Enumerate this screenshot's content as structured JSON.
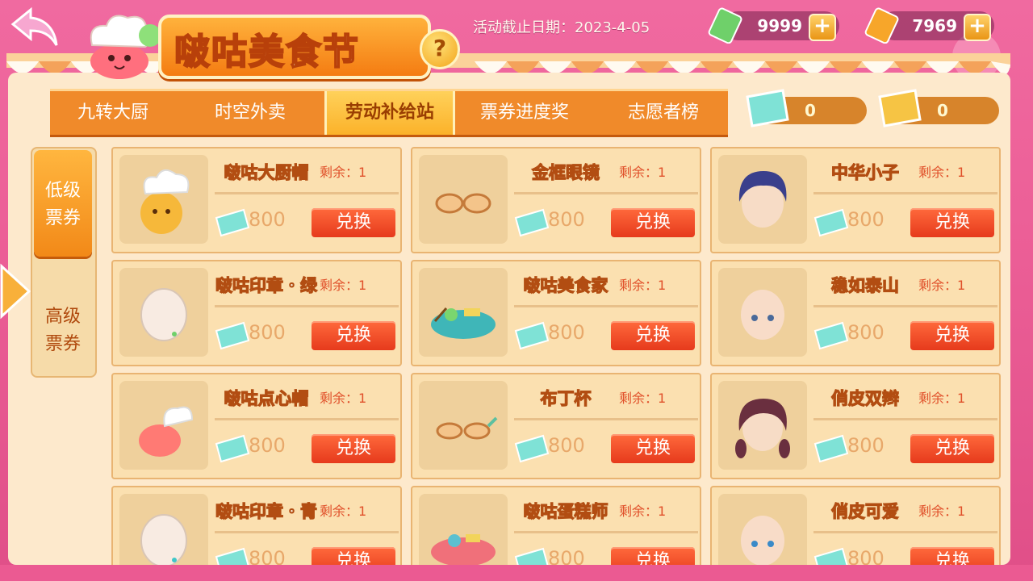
{
  "header": {
    "title": "啵咕美食节",
    "help_label": "?",
    "deadline": "活动截止日期：2023-4-05",
    "currency_green": {
      "amount": "9999",
      "icon": "green-ticket-icon"
    },
    "currency_gold": {
      "amount": "7969",
      "icon": "gold-ticket-icon"
    },
    "plus_label": "+"
  },
  "tabs": [
    {
      "label": "九转大厨",
      "active": false
    },
    {
      "label": "时空外卖",
      "active": false
    },
    {
      "label": "劳动补给站",
      "active": true
    },
    {
      "label": "票券进度奖",
      "active": false
    },
    {
      "label": "志愿者榜",
      "active": false
    }
  ],
  "tickets": {
    "low": {
      "count": "0",
      "icon": "cyan-ticket-icon"
    },
    "high": {
      "count": "0",
      "icon": "gold-ticket-icon"
    }
  },
  "side_tabs": [
    {
      "line1": "低级",
      "line2": "票券",
      "active": true
    },
    {
      "line1": "高级",
      "line2": "票券",
      "active": false
    }
  ],
  "items": [
    {
      "name": "啵咕大厨帽",
      "remain": "剩余：1",
      "price": "800",
      "button": "兑换",
      "icon": "chef-hat-icon"
    },
    {
      "name": "金框眼镜",
      "remain": "剩余：1",
      "price": "800",
      "button": "兑换",
      "icon": "glasses-icon"
    },
    {
      "name": "中华小子",
      "remain": "剩余：1",
      "price": "800",
      "button": "兑换",
      "icon": "blue-hair-head-icon"
    },
    {
      "name": "啵咕印章・绿",
      "remain": "剩余：1",
      "price": "800",
      "button": "兑换",
      "icon": "green-stamp-head-icon"
    },
    {
      "name": "啵咕美食家",
      "remain": "剩余：1",
      "price": "800",
      "button": "兑换",
      "icon": "food-mount-icon"
    },
    {
      "name": "稳如泰山",
      "remain": "剩余：1",
      "price": "800",
      "button": "兑换",
      "icon": "bald-head-icon"
    },
    {
      "name": "啵咕点心帽",
      "remain": "剩余：1",
      "price": "800",
      "button": "兑换",
      "icon": "dessert-hat-icon"
    },
    {
      "name": "布丁杯",
      "remain": "剩余：1",
      "price": "800",
      "button": "兑换",
      "icon": "pudding-glasses-icon"
    },
    {
      "name": "俏皮双辫",
      "remain": "剩余：1",
      "price": "800",
      "button": "兑换",
      "icon": "braids-head-icon"
    },
    {
      "name": "啵咕印章・青",
      "remain": "剩余：1",
      "price": "800",
      "button": "兑换",
      "icon": "cyan-stamp-head-icon"
    },
    {
      "name": "啵咕蛋糕师",
      "remain": "剩余：1",
      "price": "800",
      "button": "兑换",
      "icon": "cake-mount-icon"
    },
    {
      "name": "俏皮可爱",
      "remain": "剩余：1",
      "price": "800",
      "button": "兑换",
      "icon": "cute-head-icon"
    }
  ]
}
